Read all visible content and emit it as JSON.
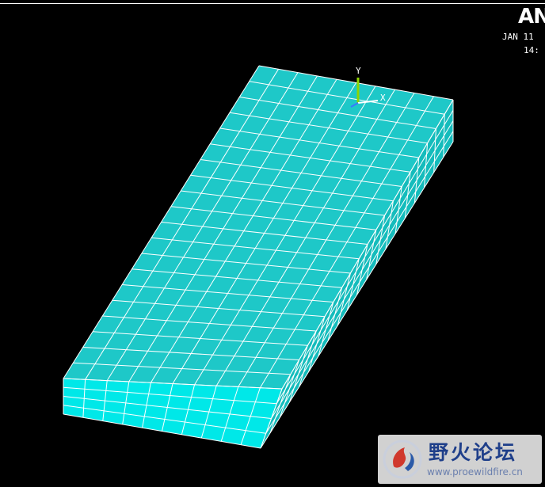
{
  "header": {
    "logo_text": "AN",
    "date": "JAN 11",
    "time": "14:"
  },
  "triad": {
    "y_label": "Y",
    "x_label": "X"
  },
  "watermark": {
    "title": "野火论坛",
    "url": "www.proewildfire.cn"
  },
  "colors": {
    "background": "#000000",
    "mesh_fill": "#1ec8c8",
    "mesh_side_fill": "#14bcbc",
    "mesh_front_fill": "#00e8e8",
    "mesh_lines": "#ffffff",
    "triad_y": "#8fd400",
    "triad_x": "#ffffff",
    "triad_z": "#3a78ff",
    "watermark_text": "#1f3f8a"
  },
  "model": {
    "type": "meshed-rectangular-slab",
    "divisions_length": 20,
    "divisions_width": 10,
    "divisions_thickness": 4
  }
}
